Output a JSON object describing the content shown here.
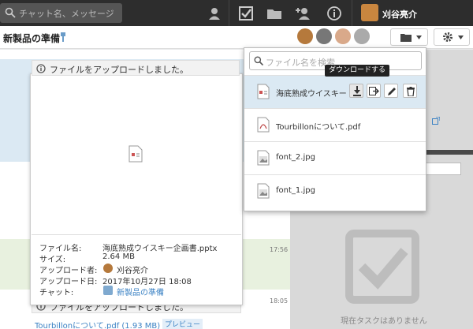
{
  "topbar": {
    "search_placeholder": "チャット名、メッセージ",
    "user_name": "刈谷亮介",
    "icons": [
      "person-icon",
      "task-check-icon",
      "folder-icon",
      "add-contact-icon",
      "info-icon"
    ]
  },
  "room": {
    "title": "新製品の準備"
  },
  "files_panel": {
    "search_placeholder": "ファイル名を検索",
    "tooltip": "ダウンロードする",
    "files": [
      {
        "name": "海底熟成ウイスキー",
        "icon": "pptx-file-icon"
      },
      {
        "name": "Tourbillonについて.pdf",
        "icon": "pdf-file-icon"
      },
      {
        "name": "font_2.jpg",
        "icon": "image-file-icon"
      },
      {
        "name": "font_1.jpg",
        "icon": "image-file-icon"
      }
    ]
  },
  "preview": {
    "notice": "ファイルをアップロードしました。",
    "meta_labels": [
      "ファイル名:",
      "サイズ:",
      "アップロード者:",
      "アップロード日:",
      "チャット:"
    ],
    "file_name": "海底熟成ウイスキー企画書.pptx",
    "size": "2.64 MB",
    "uploader": "刈谷亮介",
    "upload_date": "2017年10月27日 18:08",
    "chat": "新製品の準備"
  },
  "chat": {
    "time1": "17:56",
    "time2": "18:05",
    "notice2": "ファイルをアップロードしました。",
    "bottom_link": "Tourbillonについて.pdf (1.93 MB)",
    "bottom_badge": "プレビュー"
  },
  "sidebar": {
    "empty_text": "現在タスクはありません"
  },
  "colors": {
    "accent": "#3b82c4",
    "topbar": "#2d2d2d",
    "highlight": "#dbe9f3"
  }
}
